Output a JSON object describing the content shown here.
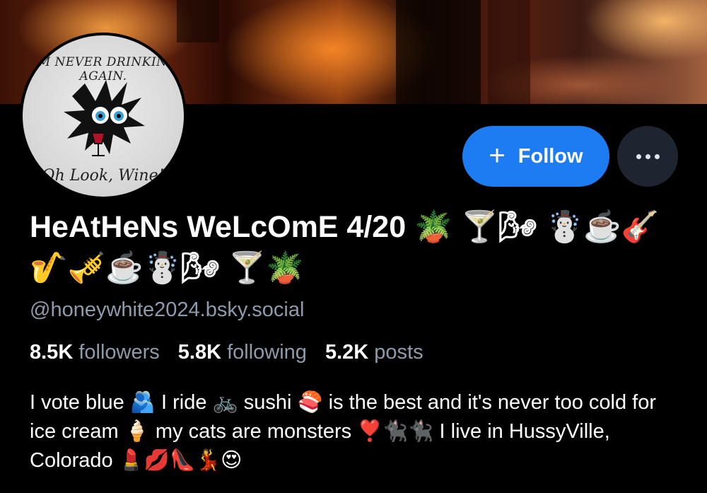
{
  "banner": {
    "description_icon": "fire-banner"
  },
  "avatar": {
    "text_top_line1": "I'M NEVER DRINKING",
    "text_top_line2": "AGAIN.",
    "text_bottom": "Oh Look, Wine!"
  },
  "actions": {
    "follow_label": "Follow",
    "follow_icon": "plus-icon",
    "more_icon": "ellipsis-icon",
    "accent": "#1d7cf2"
  },
  "profile": {
    "display_name": "HeAtHeNs WeLcOmE 4/20 🪴 🍸🌬 ☃️☕️🎸🎷🎺☕️☃️🌬 🍸🪴",
    "handle": "@honeywhite2024.bsky.social",
    "followers_count": "8.5K",
    "followers_label": "followers",
    "following_count": "5.8K",
    "following_label": "following",
    "posts_count": "5.2K",
    "posts_label": "posts",
    "bio": "I vote blue 🫂 I ride 🚲 sushi 🍣 is the best and it's never too cold for ice cream 🍦 my cats are monsters ❣️🐈‍⬛🐈‍⬛ I live in HussyVille, Colorado 💄💋👠💃😍"
  }
}
